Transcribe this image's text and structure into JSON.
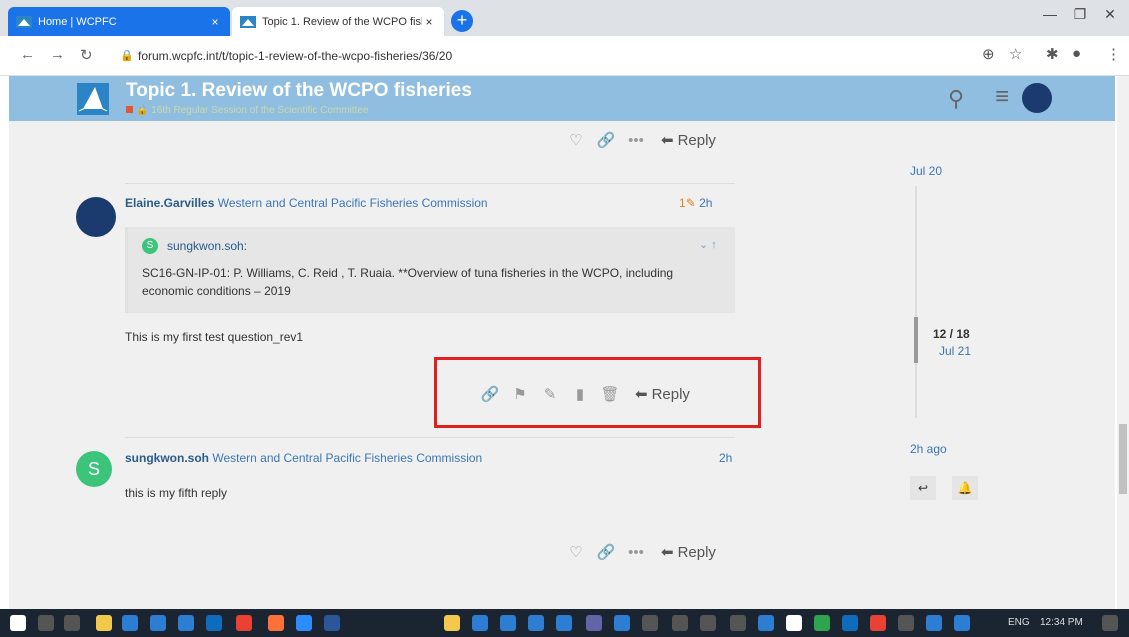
{
  "browser": {
    "tabs": [
      {
        "label": "Home | WCPFC"
      },
      {
        "label": "Topic 1. Review of the WCPO fish"
      }
    ],
    "new_tab": "+",
    "close_glyph": "×",
    "url": "forum.wcpfc.int/t/topic-1-review-of-the-wcpo-fisheries/36/20"
  },
  "header": {
    "title": "Topic 1. Review of the WCPO fisheries",
    "category": "16th Regular Session of the Scientific Committee"
  },
  "posts": [
    {
      "author": "Elaine.Garvilles",
      "org": "Western and Central Pacific Fisheries Commission",
      "edits": "1",
      "time": "2h",
      "quote": {
        "author": "sungkwon.soh:",
        "avatar_letter": "S",
        "text": "SC16-GN-IP-01: P. Williams, C. Reid , T. Ruaia. **Overview of tuna fisheries in the WCPO, including economic conditions – 2019"
      },
      "body": "This is my first test question_rev1"
    },
    {
      "author": "sungkwon.soh",
      "avatar_letter": "S",
      "org": "Western and Central Pacific Fisheries Commission",
      "time": "2h",
      "body": "this is my fifth reply"
    }
  ],
  "actions": {
    "reply_label": "Reply"
  },
  "timeline": {
    "top_date": "Jul 20",
    "position": "12 / 18",
    "position_date": "Jul 21",
    "bottom_date": "2h ago"
  },
  "taskbar": {
    "lang": "ENG",
    "time": "12:34 PM"
  },
  "colors": {
    "header_bg": "#8fbee0",
    "accent_link": "#3b76b5",
    "highlight_box": "#e02020",
    "taskbar": "#1b2431"
  }
}
